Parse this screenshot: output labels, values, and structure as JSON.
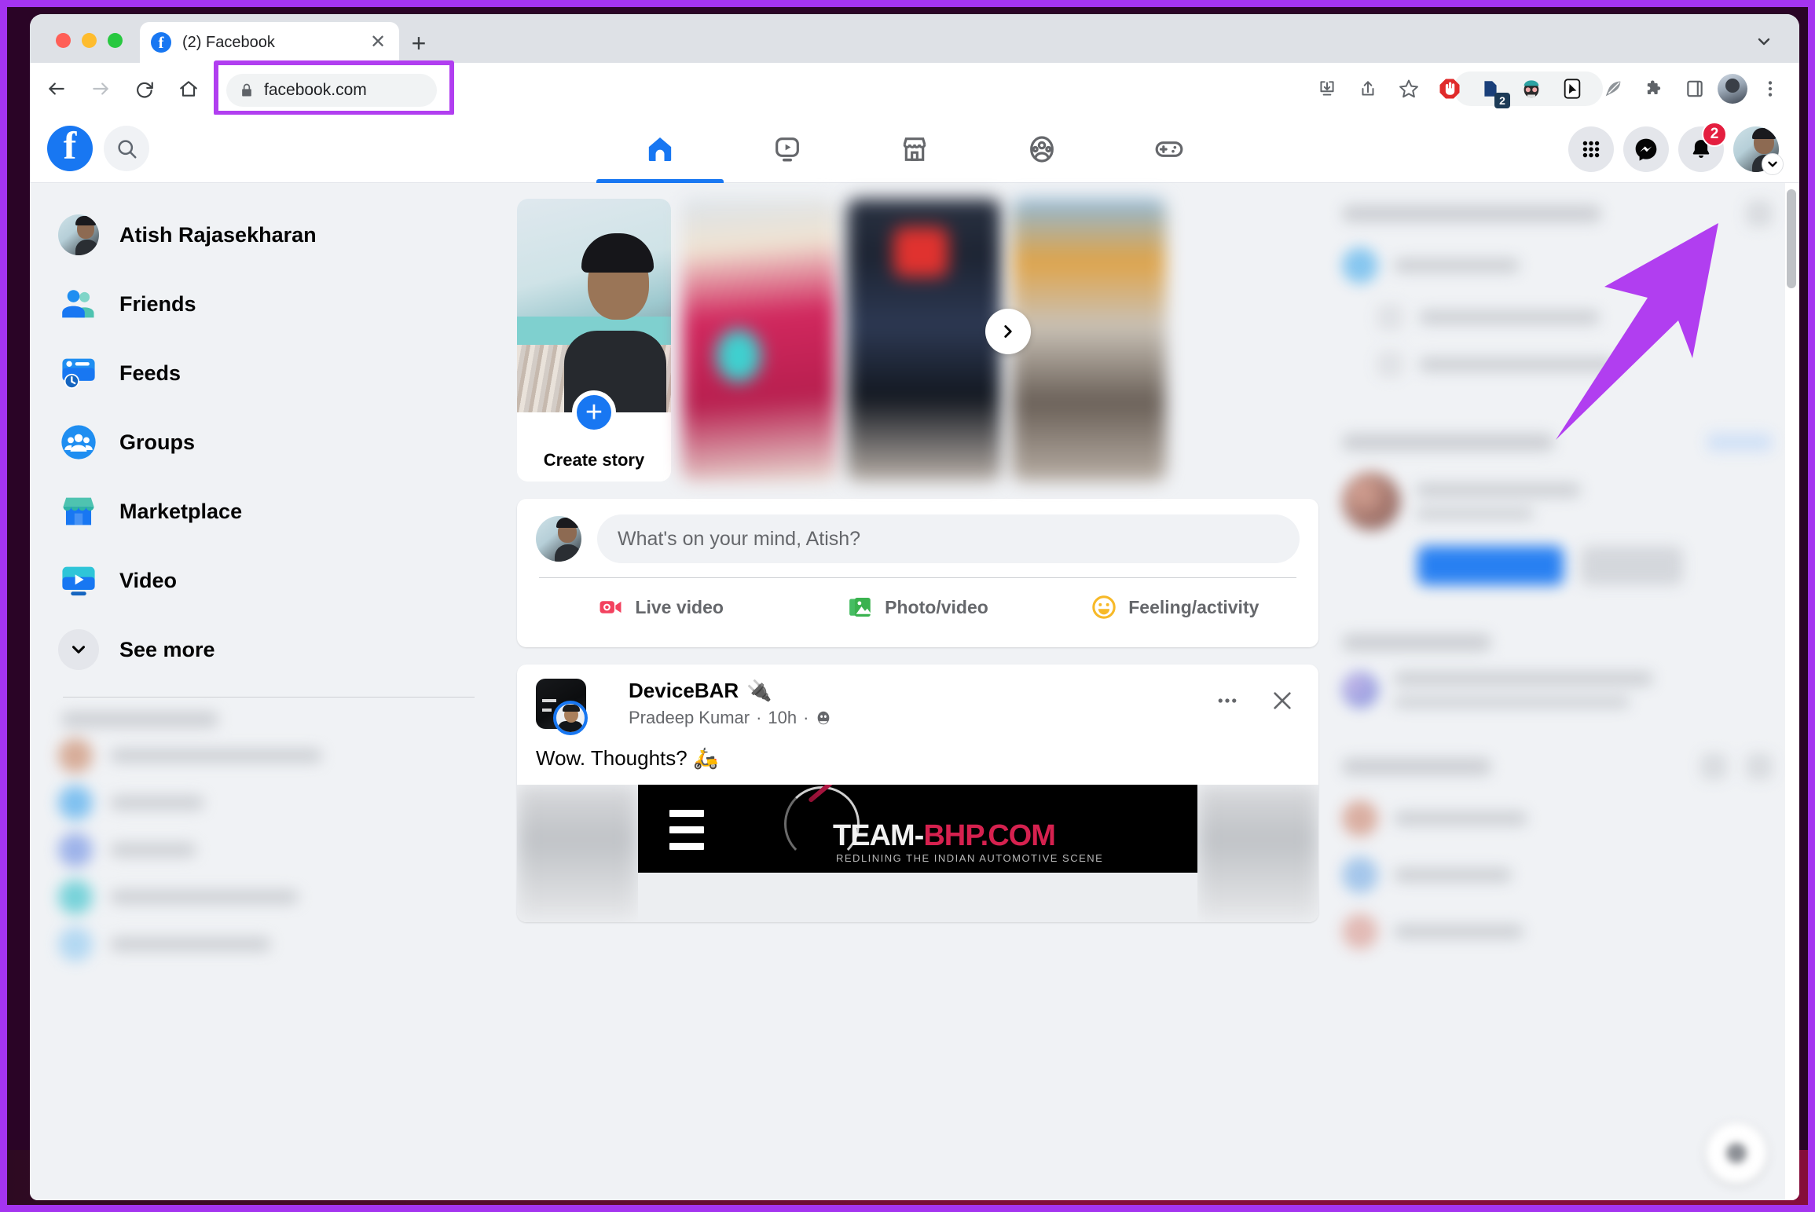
{
  "browser": {
    "tab": {
      "title": "(2) Facebook",
      "favicon_icon": "facebook-favicon",
      "close_icon": "close-icon"
    },
    "new_tab_icon": "plus-icon",
    "tabstrip_chevron_icon": "chevron-down-icon",
    "traffic_lights": [
      "close-red",
      "minimize-yellow",
      "maximize-green"
    ],
    "nav": {
      "back_icon": "arrow-left-icon",
      "forward_icon": "arrow-right-icon",
      "reload_icon": "reload-icon",
      "home_icon": "home-icon"
    },
    "omnibox": {
      "lock_icon": "lock-icon",
      "url": "facebook.com",
      "highlight_color": "#b13ef0"
    },
    "toolbar_icons": [
      {
        "name": "install-app-icon",
        "badge": ""
      },
      {
        "name": "share-icon",
        "badge": ""
      },
      {
        "name": "bookmark-star-icon",
        "badge": ""
      },
      {
        "name": "adblock-extension-icon",
        "badge": ""
      },
      {
        "name": "tab-manager-extension-icon",
        "badge": "2"
      },
      {
        "name": "avatar-extension-icon",
        "badge": ""
      },
      {
        "name": "cursor-extension-icon",
        "badge": ""
      },
      {
        "name": "feather-extension-icon",
        "badge": ""
      },
      {
        "name": "extensions-puzzle-icon",
        "badge": ""
      },
      {
        "name": "side-panel-icon",
        "badge": ""
      },
      {
        "name": "chrome-profile-avatar",
        "badge": ""
      },
      {
        "name": "chrome-menu-icon",
        "badge": ""
      }
    ]
  },
  "facebook": {
    "logo_icon": "facebook-logo-icon",
    "search_icon": "search-icon",
    "tabs": [
      {
        "label": "Home",
        "icon": "home-icon",
        "active": true
      },
      {
        "label": "Video",
        "icon": "video-icon",
        "active": false
      },
      {
        "label": "Marketplace",
        "icon": "marketplace-icon",
        "active": false
      },
      {
        "label": "Groups",
        "icon": "groups-icon",
        "active": false
      },
      {
        "label": "Gaming",
        "icon": "gaming-controller-icon",
        "active": false
      }
    ],
    "nav_right": [
      {
        "name": "menu-grid-icon",
        "badge": ""
      },
      {
        "name": "messenger-icon",
        "badge": ""
      },
      {
        "name": "notifications-bell-icon",
        "badge": "2"
      }
    ],
    "account": {
      "name": "Atish Rajasekharan",
      "avatar_icon": "profile-avatar",
      "chevron_icon": "chevron-down-icon"
    },
    "sidebar": {
      "items": [
        {
          "label": "Atish Rajasekharan",
          "icon": "profile-avatar"
        },
        {
          "label": "Friends",
          "icon": "friends-icon"
        },
        {
          "label": "Feeds",
          "icon": "feeds-icon"
        },
        {
          "label": "Groups",
          "icon": "groups-icon"
        },
        {
          "label": "Marketplace",
          "icon": "marketplace-icon"
        },
        {
          "label": "Video",
          "icon": "video-icon"
        },
        {
          "label": "See more",
          "icon": "chevron-down-icon"
        }
      ]
    },
    "stories": {
      "create": {
        "label": "Create story",
        "plus_icon": "plus-icon"
      },
      "next_icon": "chevron-right-icon",
      "count": 4
    },
    "composer": {
      "placeholder": "What's on your mind, Atish?",
      "avatar_icon": "profile-avatar",
      "actions": [
        {
          "label": "Live video",
          "icon": "live-video-icon",
          "color": "#f3425f"
        },
        {
          "label": "Photo/video",
          "icon": "photo-video-icon",
          "color": "#45bd62"
        },
        {
          "label": "Feeling/activity",
          "icon": "feeling-activity-icon",
          "color": "#f7b928"
        }
      ]
    },
    "post": {
      "page_name": "DeviceBAR",
      "page_name_emoji": "🔌",
      "author": "Pradeep Kumar",
      "time": "10h",
      "audience_icon": "public-globe-icon",
      "meta_separator": "·",
      "body": "Wow. Thoughts?",
      "body_emoji": "🛵",
      "more_icon": "ellipsis-icon",
      "close_icon": "close-icon",
      "media": {
        "banner_wordmark_white": "TEAM-",
        "banner_wordmark_red": "BHP.COM",
        "banner_tagline": "REDLINING THE INDIAN AUTOMOTIVE SCENE",
        "hamburger_icon": "hamburger-menu-icon"
      }
    },
    "fab_icon": "chat-fab-icon",
    "scrollbar_icon": "vertical-scrollbar"
  },
  "annotation": {
    "arrow_color": "#b13ef0",
    "frame_color": "#a434f0",
    "arrow_icon": "pointer-arrow-annotation"
  }
}
